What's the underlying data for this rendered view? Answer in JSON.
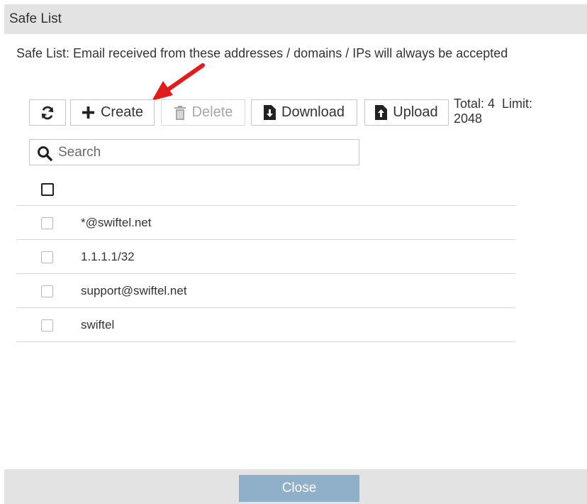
{
  "dialog": {
    "title": "Safe List",
    "description": "Safe List: Email received from these addresses / domains / IPs will always be accepted"
  },
  "toolbar": {
    "create_label": "Create",
    "delete_label": "Delete",
    "download_label": "Download",
    "upload_label": "Upload",
    "total_label": "Total: 4",
    "limit_label": "Limit:",
    "limit_value": "2048",
    "icons": {
      "refresh": "refresh-icon",
      "create": "plus-icon",
      "delete": "trash-icon",
      "download": "download-file-icon",
      "upload": "upload-file-icon"
    }
  },
  "search": {
    "placeholder": "Search",
    "value": ""
  },
  "table": {
    "header_checkbox_checked": false,
    "rows": [
      {
        "value": "*@swiftel.net",
        "checked": false
      },
      {
        "value": "1.1.1.1/32",
        "checked": false
      },
      {
        "value": "support@swiftel.net",
        "checked": false
      },
      {
        "value": "swiftel",
        "checked": false
      }
    ]
  },
  "footer": {
    "close_label": "Close"
  },
  "colors": {
    "title_bar": "#e3e3e3",
    "close_button": "#8fb0c8",
    "annotation_arrow": "#e31b1b",
    "disabled_text": "#a7a7a7",
    "border": "#c6c6c6"
  }
}
